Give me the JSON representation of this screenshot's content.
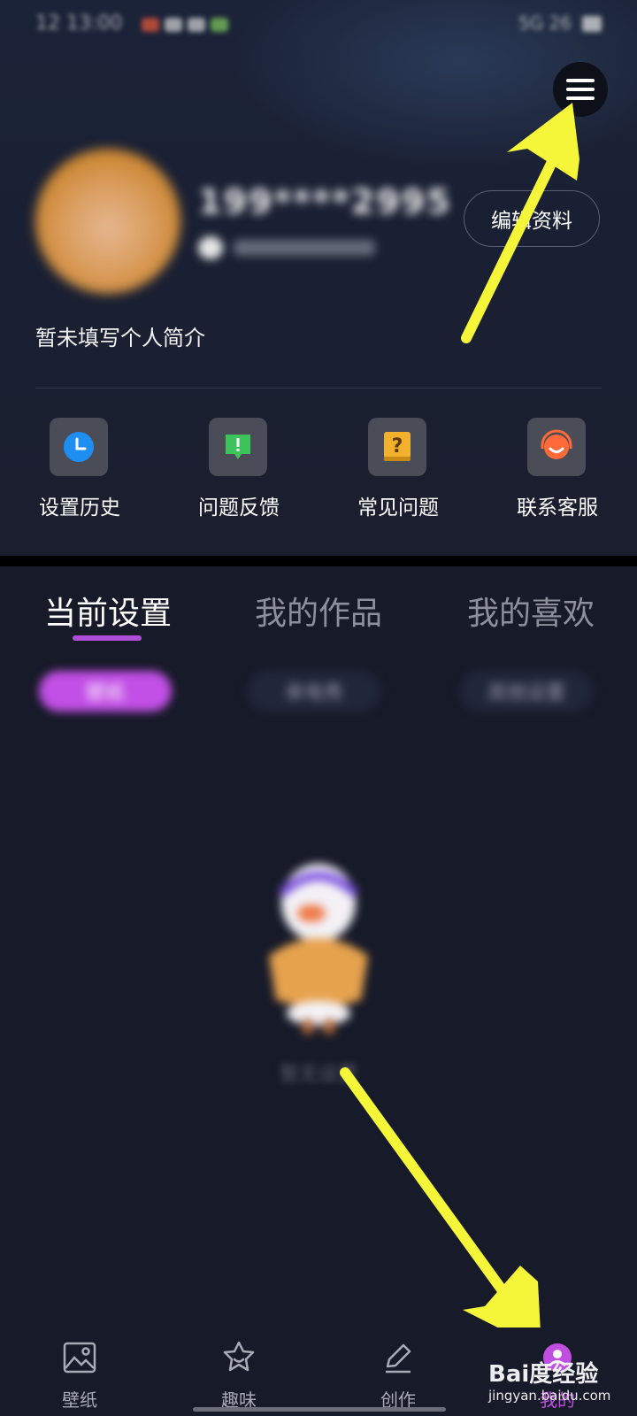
{
  "status_bar": {
    "time": "12 13:00",
    "right": "5G 26"
  },
  "menu": {
    "icon": "hamburger-menu-icon"
  },
  "profile": {
    "username": "199****2995",
    "edit_button": "编辑资料",
    "bio": "暂未填写个人简介"
  },
  "quick_actions": [
    {
      "label": "设置历史",
      "icon": "clock-icon",
      "color": "#1e8ef0"
    },
    {
      "label": "问题反馈",
      "icon": "feedback-icon",
      "color": "#3cc35a"
    },
    {
      "label": "常见问题",
      "icon": "question-book-icon",
      "color": "#f2b12c"
    },
    {
      "label": "联系客服",
      "icon": "headset-icon",
      "color": "#ff6a3a"
    }
  ],
  "tabs": [
    {
      "label": "当前设置",
      "active": true
    },
    {
      "label": "我的作品",
      "active": false
    },
    {
      "label": "我的喜欢",
      "active": false
    }
  ],
  "filter_chips": [
    "壁纸",
    "来电秀",
    "其他设置"
  ],
  "empty_state": {
    "text": "暂无设置"
  },
  "bottom_nav": [
    {
      "label": "壁纸",
      "icon": "wallpaper-icon",
      "active": false
    },
    {
      "label": "趣味",
      "icon": "fun-star-icon",
      "active": false
    },
    {
      "label": "创作",
      "icon": "pen-icon",
      "active": false
    },
    {
      "label": "我的",
      "icon": "profile-icon",
      "active": true
    }
  ],
  "watermark": {
    "brand": "Bai度经验",
    "url": "jingyan.baidu.com"
  },
  "colors": {
    "accent": "#c04ee0",
    "annotation_arrow": "#f5f53a"
  }
}
